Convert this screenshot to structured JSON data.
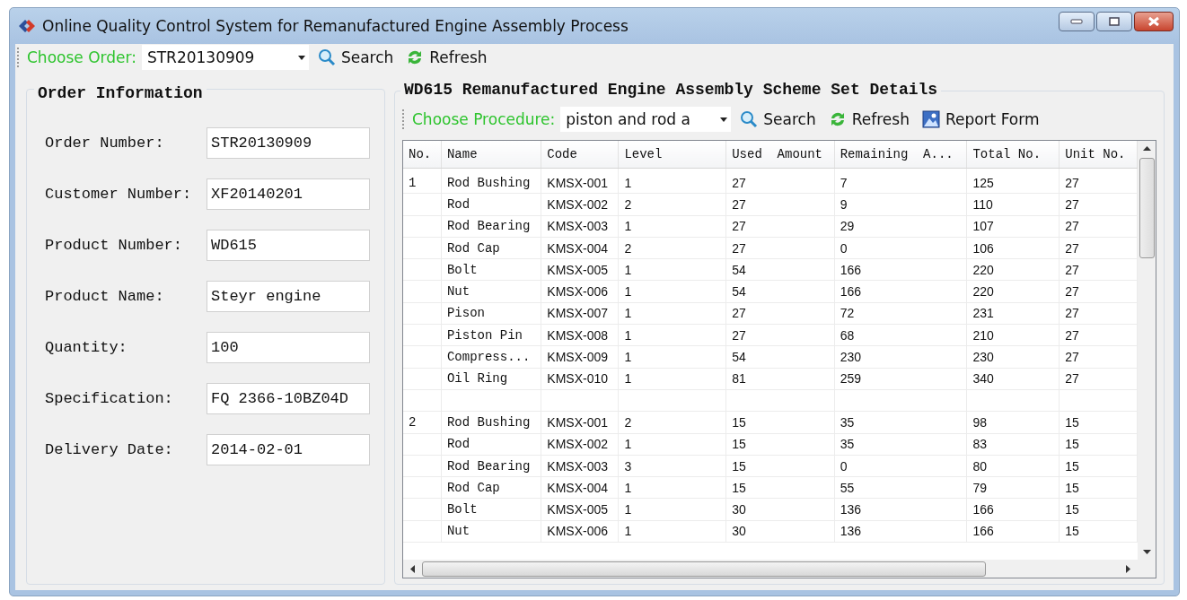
{
  "window": {
    "title": "Online Quality Control System for Remanufactured Engine Assembly Process"
  },
  "toolbar": {
    "label": "Choose Order:",
    "order": "STR20130909",
    "search": "Search",
    "refresh": "Refresh"
  },
  "order_info": {
    "title": "Order Information",
    "fields": [
      {
        "label": "Order Number:",
        "value": "STR20130909"
      },
      {
        "label": "Customer Number:",
        "value": "XF20140201"
      },
      {
        "label": "Product Number:",
        "value": "WD615"
      },
      {
        "label": "Product Name:",
        "value": "Steyr engine"
      },
      {
        "label": "Quantity:",
        "value": "100"
      },
      {
        "label": "Specification:",
        "value": "FQ 2366-10BZ04D"
      },
      {
        "label": "Delivery Date:",
        "value": "2014-02-01"
      }
    ]
  },
  "details": {
    "title": "WD615 Remanufactured Engine Assembly Scheme Set Details",
    "toolbar": {
      "label": "Choose Procedure:",
      "procedure": "piston and rod a",
      "search": "Search",
      "refresh": "Refresh",
      "report": "Report Form"
    },
    "table": {
      "columns": [
        "No.",
        "Name",
        "Code",
        "Level",
        "Used  Amount",
        "Remaining  A...",
        "Total No.",
        "Unit No."
      ],
      "rows": [
        {
          "kind": "item",
          "no": "1",
          "cells": [
            "Rod Bushing",
            "KMSX-001",
            "1",
            "27",
            "7",
            "125",
            "27"
          ]
        },
        {
          "kind": "item",
          "cells": [
            "Rod",
            "KMSX-002",
            "2",
            "27",
            "9",
            "110",
            "27"
          ]
        },
        {
          "kind": "item",
          "cells": [
            "Rod Bearing",
            "KMSX-003",
            "1",
            "27",
            "29",
            "107",
            "27"
          ]
        },
        {
          "kind": "item",
          "cells": [
            "Rod Cap",
            "KMSX-004",
            "2",
            "27",
            "0",
            "106",
            "27"
          ]
        },
        {
          "kind": "item",
          "cells": [
            "Bolt",
            "KMSX-005",
            "1",
            "54",
            "166",
            "220",
            "27"
          ]
        },
        {
          "kind": "item",
          "cells": [
            "Nut",
            "KMSX-006",
            "1",
            "54",
            "166",
            "220",
            "27"
          ]
        },
        {
          "kind": "item",
          "cells": [
            "Pison",
            "KMSX-007",
            "1",
            "27",
            "72",
            "231",
            "27"
          ]
        },
        {
          "kind": "item",
          "cells": [
            "Piston Pin",
            "KMSX-008",
            "1",
            "27",
            "68",
            "210",
            "27"
          ]
        },
        {
          "kind": "item",
          "cells": [
            "Compress...",
            "KMSX-009",
            "1",
            "54",
            "230",
            "230",
            "27"
          ]
        },
        {
          "kind": "item",
          "cells": [
            "Oil Ring",
            "KMSX-010",
            "1",
            "81",
            "259",
            "340",
            "27"
          ]
        },
        {
          "kind": "spacer"
        },
        {
          "kind": "item",
          "no": "2",
          "cells": [
            "Rod Bushing",
            "KMSX-001",
            "2",
            "15",
            "35",
            "98",
            "15"
          ]
        },
        {
          "kind": "item",
          "cells": [
            "Rod",
            "KMSX-002",
            "1",
            "15",
            "35",
            "83",
            "15"
          ]
        },
        {
          "kind": "item",
          "cells": [
            "Rod Bearing",
            "KMSX-003",
            "3",
            "15",
            "0",
            "80",
            "15"
          ]
        },
        {
          "kind": "item",
          "cells": [
            "Rod Cap",
            "KMSX-004",
            "1",
            "15",
            "55",
            "79",
            "15"
          ]
        },
        {
          "kind": "item",
          "cells": [
            "Bolt",
            "KMSX-005",
            "1",
            "30",
            "136",
            "166",
            "15"
          ]
        },
        {
          "kind": "item",
          "cells": [
            "Nut",
            "KMSX-006",
            "1",
            "30",
            "136",
            "166",
            "15"
          ]
        }
      ]
    }
  }
}
